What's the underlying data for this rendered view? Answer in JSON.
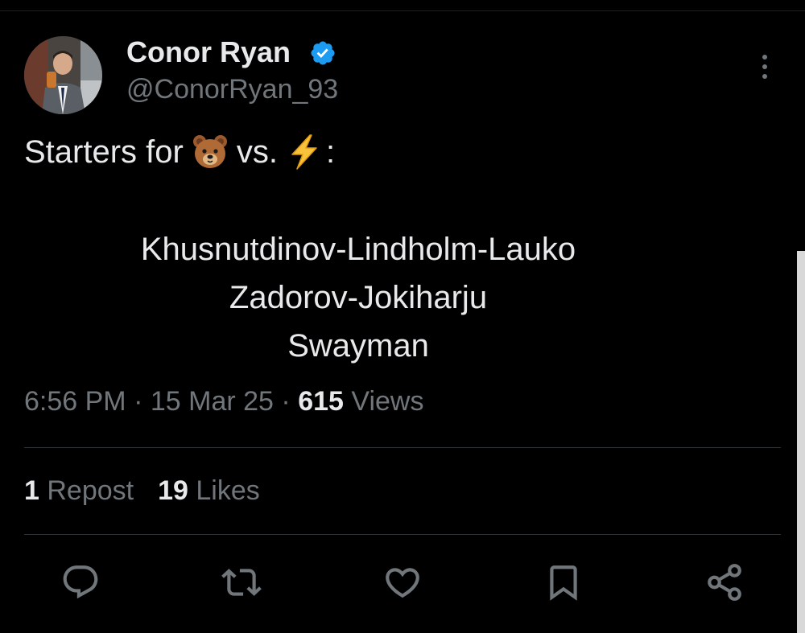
{
  "author": {
    "display_name": "Conor Ryan",
    "handle": "@ConorRyan_93",
    "verified": true
  },
  "tweet": {
    "intro_before": "Starters for",
    "emoji_1": "bear-emoji",
    "intro_middle": "vs.",
    "emoji_2": "lightning-emoji",
    "intro_after": ":",
    "lines": [
      "Khusnutdinov-Lindholm-Lauko",
      "Zadorov-Jokiharju",
      "Swayman"
    ]
  },
  "meta": {
    "time": "6:56 PM",
    "separator": "·",
    "date": "15 Mar 25",
    "views_count": "615",
    "views_label": "Views"
  },
  "stats": {
    "reposts_count": "1",
    "reposts_label": "Repost",
    "likes_count": "19",
    "likes_label": "Likes"
  },
  "actions": [
    "reply-icon",
    "repost-icon",
    "like-icon",
    "bookmark-icon",
    "share-icon"
  ],
  "colors": {
    "background": "#000000",
    "text_primary": "#e7e9ea",
    "text_secondary": "#71767b",
    "divider": "#2f3336",
    "verified_blue": "#1d9bf0"
  }
}
